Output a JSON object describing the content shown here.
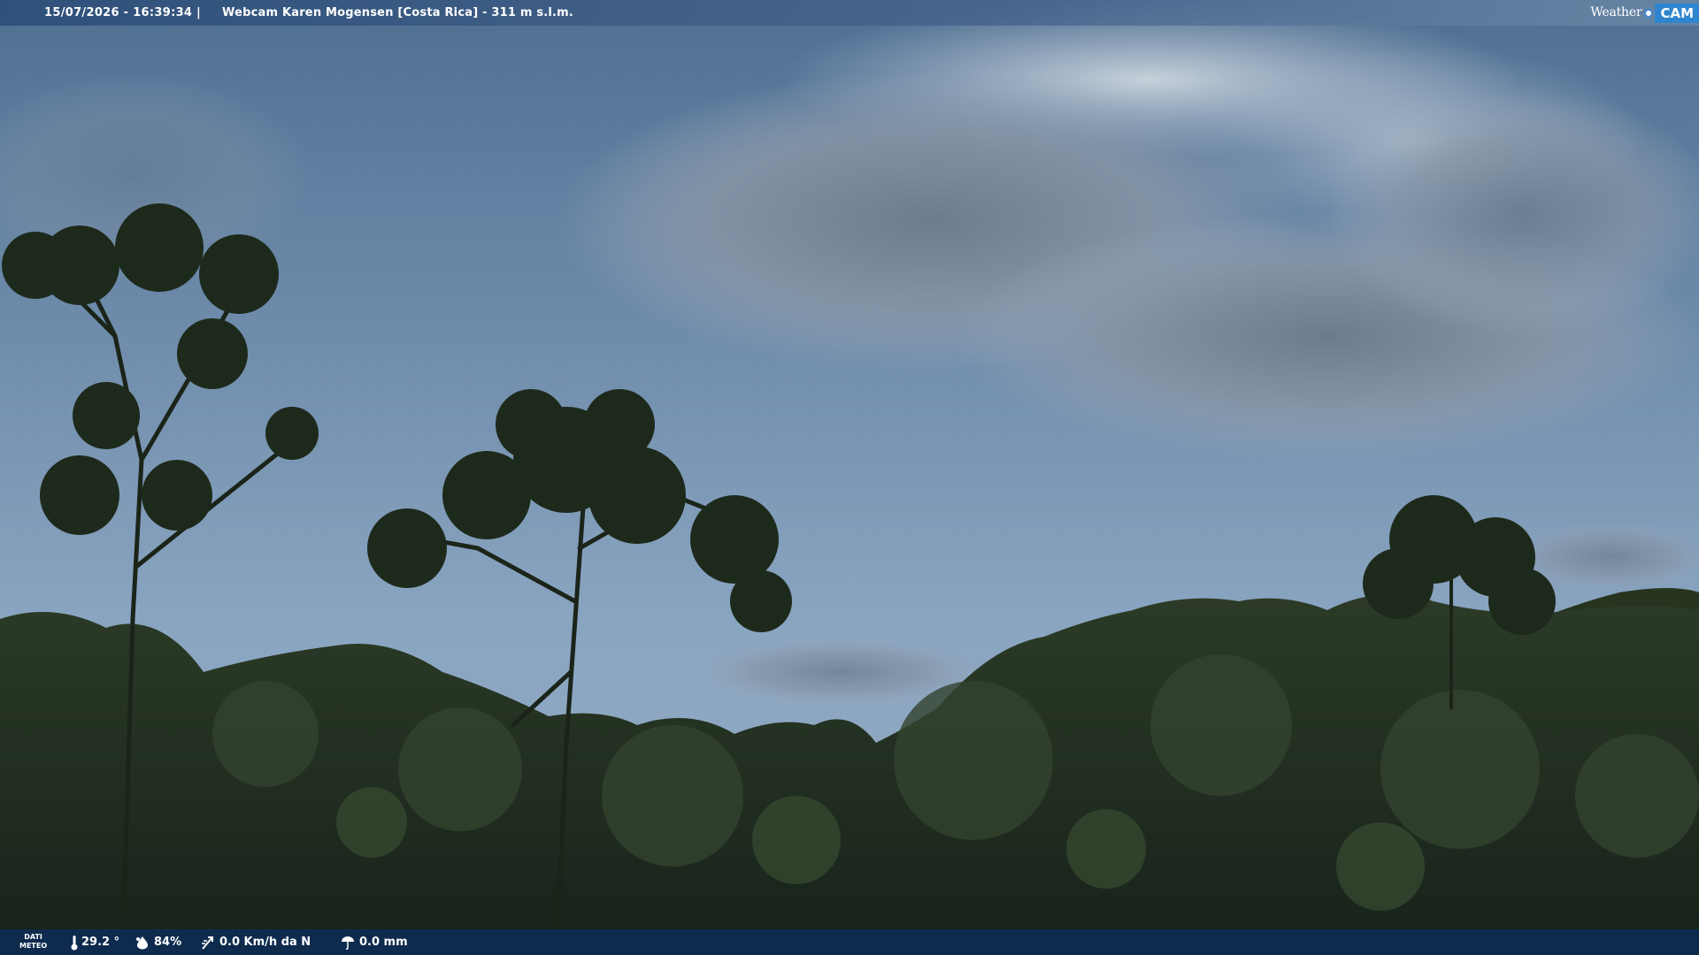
{
  "header": {
    "datetime": "15/07/2026 - 16:39:34",
    "separator": "|",
    "title": "Webcam Karen Mogensen [Costa Rica]  - 311 m s.l.m."
  },
  "brand": {
    "weather": "Weather",
    "cam": "CAM",
    "icon": "brand-dot-icon"
  },
  "weather_panel": {
    "label_line1": "DATI",
    "label_line2": "METEO",
    "temperature": "29.2 °",
    "humidity": "84%",
    "wind": "0.0 Km/h da N",
    "rain": "0.0 mm",
    "icons": [
      "thermometer-icon",
      "humidity-icon",
      "wind-icon",
      "rain-icon"
    ]
  },
  "colors": {
    "top_bar": "#2c4e78",
    "bottom_bar": "#0e2c52",
    "brand_accent": "#2f86cf",
    "sky": "#7f99b4",
    "forest": "#1f2d1c"
  }
}
